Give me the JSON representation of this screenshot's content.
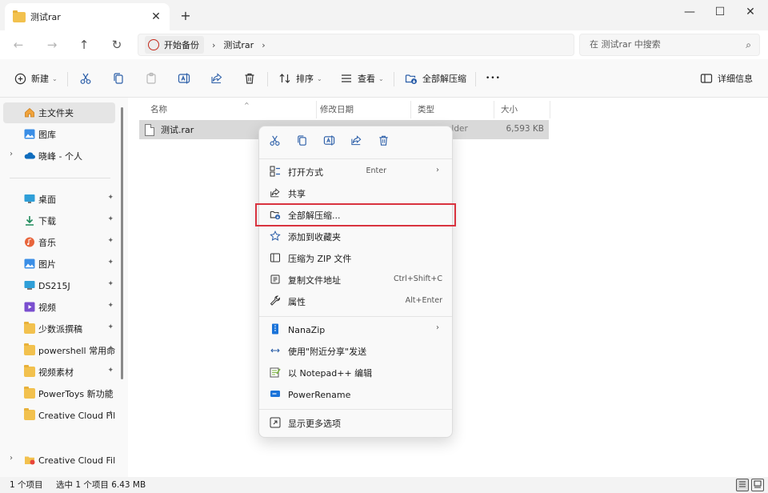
{
  "window": {
    "tab_title": "测试rar",
    "tab_close": "✕",
    "new_tab": "+",
    "minimize": "—",
    "maximize": "☐",
    "close": "✕"
  },
  "address": {
    "back": "←",
    "forward": "→",
    "up": "↑",
    "refresh": "↻",
    "home_crumb": "开始备份",
    "crumb_separator": "›",
    "current_crumb": "测试rar",
    "search_placeholder": "在 测试rar 中搜索",
    "search_icon": "⌕"
  },
  "toolbar": {
    "new_label": "新建",
    "new_caret": "⌄",
    "sort_label": "排序",
    "sort_caret": "⌄",
    "view_label": "查看",
    "view_caret": "⌄",
    "extract_label": "全部解压缩",
    "more": "•••",
    "details_label": "详细信息"
  },
  "sidebar": {
    "items": [
      {
        "label": "主文件夹",
        "icon": "home-icon",
        "selected": true
      },
      {
        "label": "图库",
        "icon": "gallery-icon"
      },
      {
        "label": "晓峰 - 个人",
        "icon": "onedrive-icon",
        "expander": "›"
      },
      {
        "label": "桌面",
        "icon": "desktop-icon",
        "pin": "✦"
      },
      {
        "label": "下载",
        "icon": "download-icon",
        "pin": "✦"
      },
      {
        "label": "音乐",
        "icon": "music-icon",
        "pin": "✦"
      },
      {
        "label": "图片",
        "icon": "pictures-icon",
        "pin": "✦"
      },
      {
        "label": "DS215J",
        "icon": "nas-drive-icon",
        "pin": "✦"
      },
      {
        "label": "视频",
        "icon": "video-icon",
        "pin": "✦"
      },
      {
        "label": "少数派撰稿",
        "icon": "folder-icon",
        "pin": "✦"
      },
      {
        "label": "powershell 常用命令",
        "icon": "folder-icon",
        "pin": "✦"
      },
      {
        "label": "视频素材",
        "icon": "folder-icon",
        "pin": "✦"
      },
      {
        "label": "PowerToys 新功能",
        "icon": "folder-icon",
        "pin": "✦"
      },
      {
        "label": "Creative Cloud Files",
        "icon": "folder-icon",
        "pin": "✦"
      },
      {
        "label": "Creative Cloud Files",
        "icon": "creative-cloud-icon",
        "expander": "›"
      }
    ]
  },
  "file_list": {
    "columns": [
      "名称",
      "修改日期",
      "类型",
      "大小"
    ],
    "sort_indicator": "^",
    "rows": [
      {
        "name": "测试.rar",
        "type_partial": "older",
        "size": "6,593 KB"
      }
    ]
  },
  "context_menu": {
    "quick_actions": [
      "cut",
      "copy",
      "rename",
      "share",
      "delete"
    ],
    "items": [
      {
        "label": "打开方式",
        "shortcut": "Enter",
        "submenu": "›",
        "icon": "open-with-icon"
      },
      {
        "label": "共享",
        "icon": "share-icon"
      },
      {
        "label": "全部解压缩...",
        "icon": "extract-all-icon",
        "highlighted": true
      },
      {
        "label": "添加到收藏夹",
        "icon": "star-icon"
      },
      {
        "label": "压缩为 ZIP 文件",
        "icon": "zip-icon"
      },
      {
        "label": "复制文件地址",
        "shortcut": "Ctrl+Shift+C",
        "icon": "copy-path-icon"
      },
      {
        "label": "属性",
        "shortcut": "Alt+Enter",
        "icon": "properties-icon"
      },
      {
        "label": "NanaZip",
        "submenu": "›",
        "icon": "nanazip-icon"
      },
      {
        "label": "使用\"附近分享\"发送",
        "icon": "nearby-share-icon"
      },
      {
        "label": "以 Notepad++ 编辑",
        "icon": "notepadpp-icon"
      },
      {
        "label": "PowerRename",
        "icon": "powerrename-icon"
      },
      {
        "label": "显示更多选项",
        "icon": "more-options-icon"
      }
    ]
  },
  "status": {
    "item_count": "1 个项目",
    "selected": "选中 1 个项目  6.43 MB"
  },
  "colors": {
    "accent": "#2b5ea8",
    "highlight_border": "#d9333f",
    "folder": "#f2c14e"
  }
}
